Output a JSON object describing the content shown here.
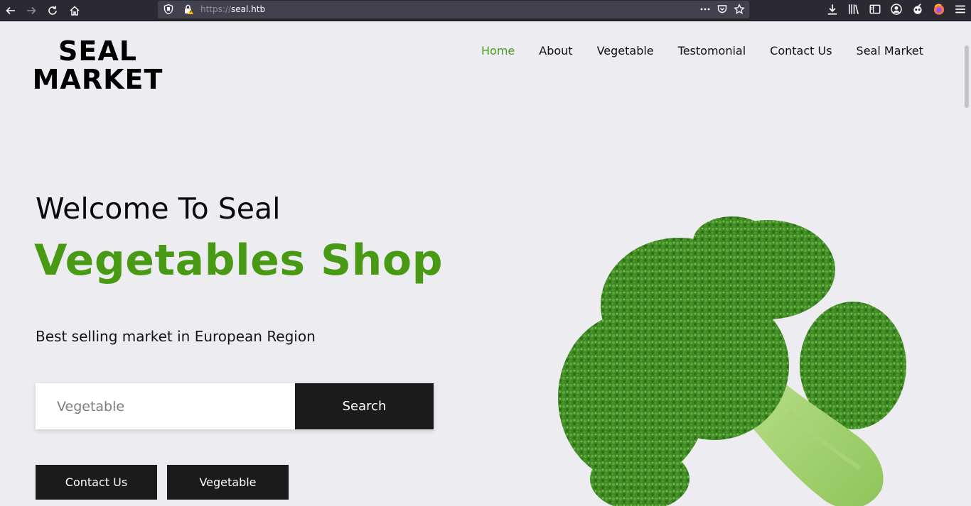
{
  "browser": {
    "url_scheme": "https://",
    "url_host": "seal.htb",
    "icons": [
      "back-icon",
      "forward-icon",
      "reload-icon",
      "home-icon",
      "shield-icon",
      "lock-warning-icon",
      "more-icon",
      "pocket-icon",
      "star-icon",
      "download-icon",
      "library-icon",
      "sidebar-icon",
      "account-icon",
      "extension-icon",
      "firefox-icon",
      "menu-icon"
    ]
  },
  "site": {
    "logo_line1": "SEAL",
    "logo_line2": "MARKET"
  },
  "nav": {
    "items": [
      "Home",
      "About",
      "Vegetable",
      "Testomonial",
      "Contact Us",
      "Seal Market"
    ],
    "active_color": "#4a9b1e"
  },
  "hero": {
    "welcome": "Welcome To Seal",
    "headline": "Vegetables Shop",
    "headline_color": "#489a14",
    "tagline": "Best selling market in European Region"
  },
  "search": {
    "placeholder": "Vegetable",
    "button_label": "Search"
  },
  "actions": {
    "contact_label": "Contact Us",
    "vegetable_label": "Vegetable"
  },
  "image": {
    "subject": "broccoli"
  }
}
